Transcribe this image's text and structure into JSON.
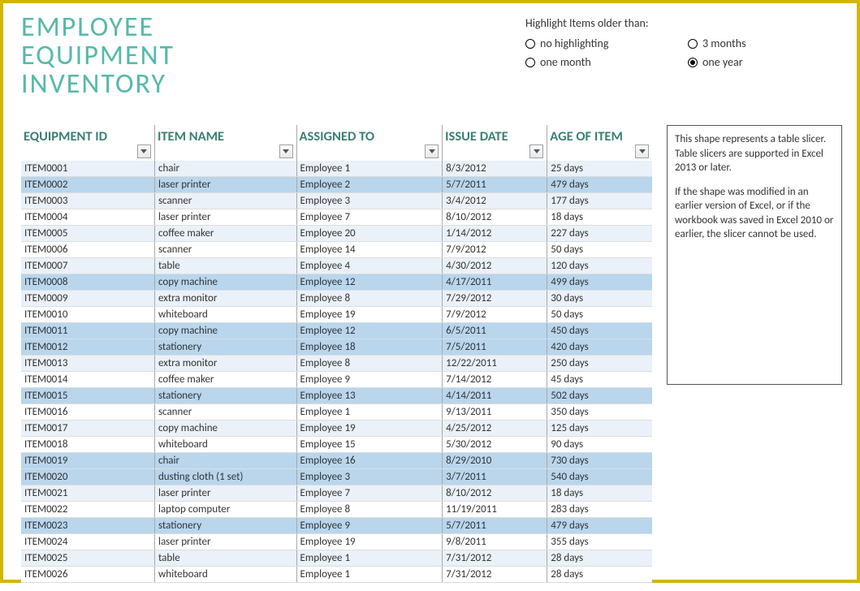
{
  "title_line1": "EMPLOYEE",
  "title_line2": "EQUIPMENT",
  "title_line3": "INVENTORY",
  "highlight": {
    "label": "Highlight Items older than:",
    "options": [
      {
        "label": "no highlighting",
        "selected": false
      },
      {
        "label": "3 months",
        "selected": false
      },
      {
        "label": "one month",
        "selected": false
      },
      {
        "label": "one year",
        "selected": true
      }
    ]
  },
  "columns": [
    "EQUIPMENT ID",
    "ITEM NAME",
    "ASSIGNED TO",
    "ISSUE DATE",
    "AGE OF ITEM"
  ],
  "rows": [
    {
      "id": "ITEM0001",
      "item": "chair",
      "assigned": "Employee 1",
      "date": "8/3/2012",
      "age": "25 days",
      "hl": false
    },
    {
      "id": "ITEM0002",
      "item": "laser printer",
      "assigned": "Employee 2",
      "date": "5/7/2011",
      "age": "479 days",
      "hl": true
    },
    {
      "id": "ITEM0003",
      "item": "scanner",
      "assigned": "Employee 3",
      "date": "3/4/2012",
      "age": "177 days",
      "hl": false
    },
    {
      "id": "ITEM0004",
      "item": "laser printer",
      "assigned": "Employee 7",
      "date": "8/10/2012",
      "age": "18 days",
      "hl": false
    },
    {
      "id": "ITEM0005",
      "item": "coffee maker",
      "assigned": "Employee 20",
      "date": "1/14/2012",
      "age": "227 days",
      "hl": false
    },
    {
      "id": "ITEM0006",
      "item": "scanner",
      "assigned": "Employee 14",
      "date": "7/9/2012",
      "age": "50 days",
      "hl": false
    },
    {
      "id": "ITEM0007",
      "item": "table",
      "assigned": "Employee 4",
      "date": "4/30/2012",
      "age": "120 days",
      "hl": false
    },
    {
      "id": "ITEM0008",
      "item": "copy machine",
      "assigned": "Employee 12",
      "date": "4/17/2011",
      "age": "499 days",
      "hl": true
    },
    {
      "id": "ITEM0009",
      "item": "extra monitor",
      "assigned": "Employee 8",
      "date": "7/29/2012",
      "age": "30 days",
      "hl": false
    },
    {
      "id": "ITEM0010",
      "item": "whiteboard",
      "assigned": "Employee 19",
      "date": "7/9/2012",
      "age": "50 days",
      "hl": false
    },
    {
      "id": "ITEM0011",
      "item": "copy machine",
      "assigned": "Employee 12",
      "date": "6/5/2011",
      "age": "450 days",
      "hl": true
    },
    {
      "id": "ITEM0012",
      "item": "stationery",
      "assigned": "Employee 18",
      "date": "7/5/2011",
      "age": "420 days",
      "hl": true
    },
    {
      "id": "ITEM0013",
      "item": "extra monitor",
      "assigned": "Employee 8",
      "date": "12/22/2011",
      "age": "250 days",
      "hl": false
    },
    {
      "id": "ITEM0014",
      "item": "coffee maker",
      "assigned": "Employee 9",
      "date": "7/14/2012",
      "age": "45 days",
      "hl": false
    },
    {
      "id": "ITEM0015",
      "item": "stationery",
      "assigned": "Employee 13",
      "date": "4/14/2011",
      "age": "502 days",
      "hl": true
    },
    {
      "id": "ITEM0016",
      "item": "scanner",
      "assigned": "Employee 1",
      "date": "9/13/2011",
      "age": "350 days",
      "hl": false
    },
    {
      "id": "ITEM0017",
      "item": "copy machine",
      "assigned": "Employee 19",
      "date": "4/25/2012",
      "age": "125 days",
      "hl": false
    },
    {
      "id": "ITEM0018",
      "item": "whiteboard",
      "assigned": "Employee 15",
      "date": "5/30/2012",
      "age": "90 days",
      "hl": false
    },
    {
      "id": "ITEM0019",
      "item": "chair",
      "assigned": "Employee 16",
      "date": "8/29/2010",
      "age": "730 days",
      "hl": true
    },
    {
      "id": "ITEM0020",
      "item": "dusting cloth (1 set)",
      "assigned": "Employee 3",
      "date": "3/7/2011",
      "age": "540 days",
      "hl": true
    },
    {
      "id": "ITEM0021",
      "item": "laser printer",
      "assigned": "Employee 7",
      "date": "8/10/2012",
      "age": "18 days",
      "hl": false
    },
    {
      "id": "ITEM0022",
      "item": "laptop computer",
      "assigned": "Employee 8",
      "date": "11/19/2011",
      "age": "283 days",
      "hl": false
    },
    {
      "id": "ITEM0023",
      "item": "stationery",
      "assigned": "Employee 9",
      "date": "5/7/2011",
      "age": "479 days",
      "hl": true
    },
    {
      "id": "ITEM0024",
      "item": "laser printer",
      "assigned": "Employee 19",
      "date": "9/8/2011",
      "age": "355 days",
      "hl": false
    },
    {
      "id": "ITEM0025",
      "item": "table",
      "assigned": "Employee 1",
      "date": "7/31/2012",
      "age": "28 days",
      "hl": false
    },
    {
      "id": "ITEM0026",
      "item": "whiteboard",
      "assigned": "Employee 1",
      "date": "7/31/2012",
      "age": "28 days",
      "hl": false
    }
  ],
  "slicer_note": {
    "p1": "This shape represents a table slicer. Table slicers are supported in Excel 2013 or later.",
    "p2": "If the shape was modified in an earlier version of Excel, or if the workbook was saved in Excel 2010 or earlier, the slicer cannot be used."
  }
}
